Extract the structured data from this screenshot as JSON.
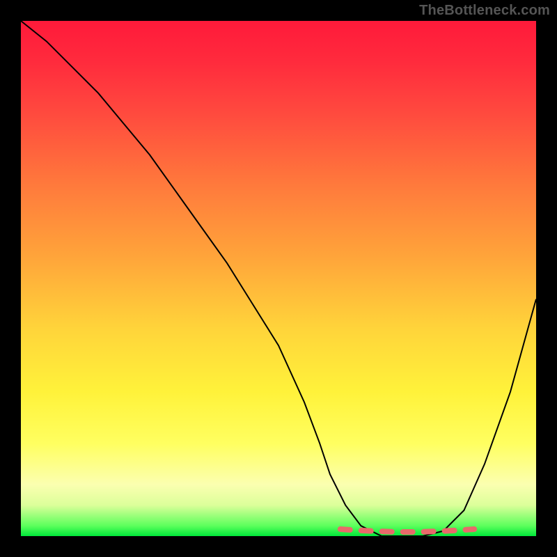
{
  "watermark": "TheBottleneck.com",
  "chart_data": {
    "type": "line",
    "title": "",
    "xlabel": "",
    "ylabel": "",
    "xlim": [
      0,
      100
    ],
    "ylim": [
      0,
      100
    ],
    "grid": false,
    "legend": false,
    "curve": {
      "x": [
        0,
        5,
        10,
        15,
        20,
        25,
        30,
        35,
        40,
        45,
        50,
        55,
        58,
        60,
        63,
        66,
        70,
        74,
        78,
        82,
        86,
        90,
        95,
        100
      ],
      "y": [
        100,
        96,
        91,
        86,
        80,
        74,
        67,
        60,
        53,
        45,
        37,
        26,
        18,
        12,
        6,
        2,
        0,
        0,
        0,
        1,
        5,
        14,
        28,
        46
      ]
    },
    "highlight_segment": {
      "x_start": 62,
      "x_end": 88,
      "y": 0
    },
    "background_gradient": {
      "stops": [
        {
          "pos": 0.0,
          "color": "#ff1a3a"
        },
        {
          "pos": 0.5,
          "color": "#ffb53a"
        },
        {
          "pos": 0.8,
          "color": "#ffff60"
        },
        {
          "pos": 0.98,
          "color": "#5cff5c"
        },
        {
          "pos": 1.0,
          "color": "#00e83a"
        }
      ]
    }
  }
}
